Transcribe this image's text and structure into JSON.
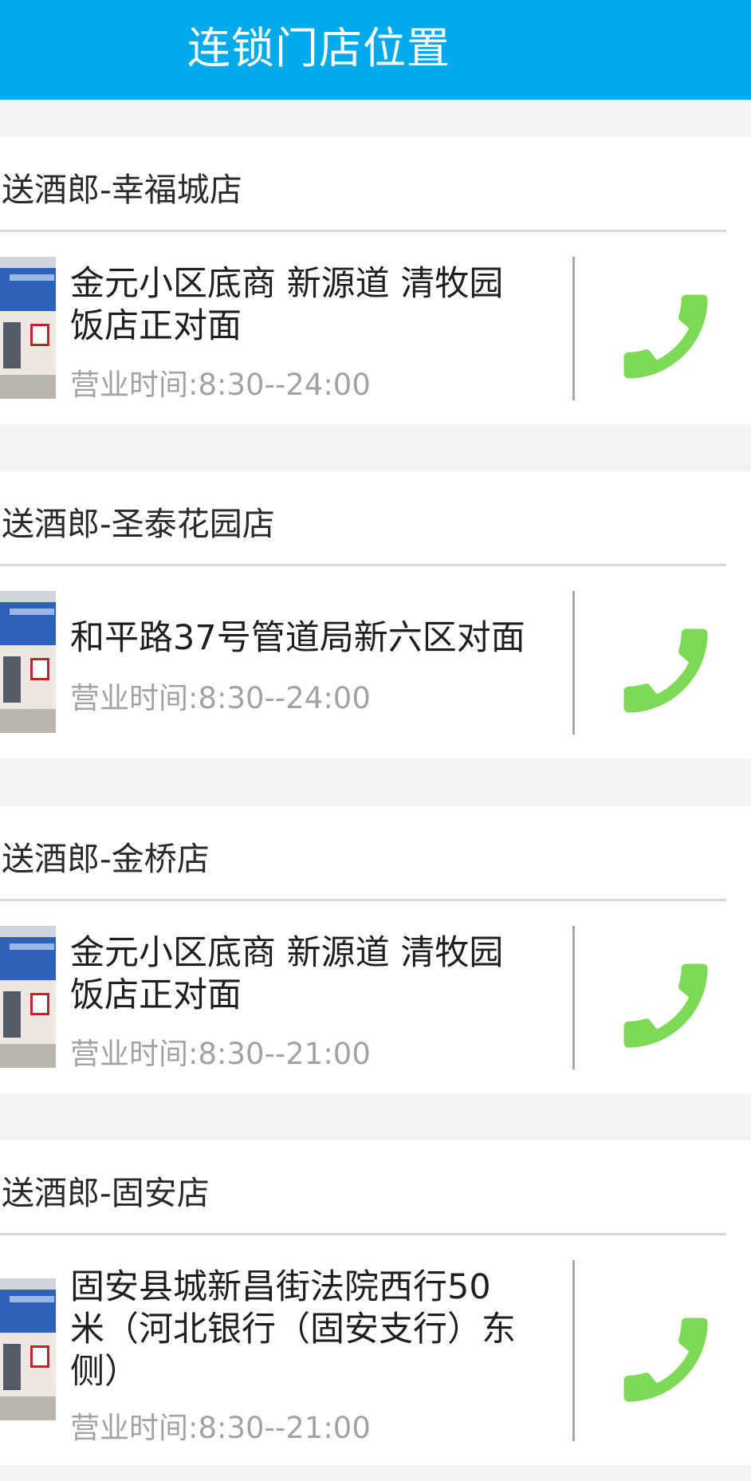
{
  "header": {
    "title": "连锁门店位置"
  },
  "theme": {
    "header_bg": "#00aaeb",
    "phone_icon_color": "#7ed957",
    "hours_color": "#a3a3a3"
  },
  "stores": [
    {
      "name": "送酒郎-幸福城店",
      "address_lines": [
        "金元小区底商 新源道 清牧园",
        "饭店正对面"
      ],
      "hours": "营业时间:8:30--24:00",
      "phone_icon": "phone-icon"
    },
    {
      "name": "送酒郎-圣泰花园店",
      "address_lines": [
        "和平路37号管道局新六区对面"
      ],
      "hours": "营业时间:8:30--24:00",
      "phone_icon": "phone-icon"
    },
    {
      "name": "送酒郎-金桥店",
      "address_lines": [
        "金元小区底商 新源道 清牧园",
        "饭店正对面"
      ],
      "hours": "营业时间:8:30--21:00",
      "phone_icon": "phone-icon"
    },
    {
      "name": "送酒郎-固安店",
      "address_lines": [
        "固安县城新昌街法院西行50",
        "米（河北银行（固安支行）东",
        "侧）"
      ],
      "hours": "营业时间:8:30--21:00",
      "phone_icon": "phone-icon"
    }
  ]
}
